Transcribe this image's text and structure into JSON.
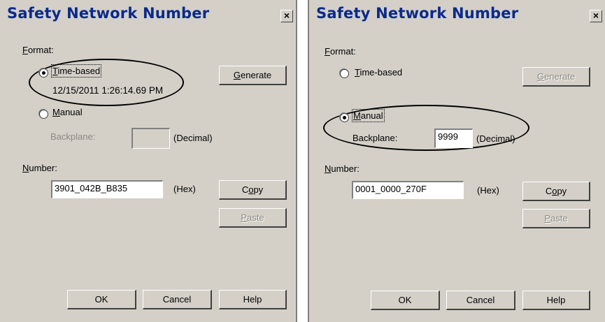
{
  "left_dialog": {
    "title": "Safety Network Number",
    "close": "×",
    "format_label_first": "F",
    "format_label_rest": "ormat:",
    "time_based_label_first": "T",
    "time_based_label_rest": "ime-based",
    "time_based_selected": true,
    "timestamp": "12/15/2011 1:26:14.69 PM",
    "generate_button_first": "G",
    "generate_button_rest": "enerate",
    "manual_label_first": "M",
    "manual_label_rest": "anual",
    "manual_selected": false,
    "backplane_label": "Backplane:",
    "backplane_value": "",
    "decimal_label": "(Decimal)",
    "number_label_first": "N",
    "number_label_rest": "umber:",
    "number_value": "3901_042B_B835",
    "hex_label": "(Hex)",
    "copy_button_first": "C",
    "copy_button_mid": "o",
    "copy_button_rest": "py",
    "paste_button_first": "P",
    "paste_button_rest": "aste",
    "ok_button": "OK",
    "cancel_button": "Cancel",
    "help_button": "Help"
  },
  "right_dialog": {
    "title": "Safety Network Number",
    "close": "×",
    "format_label_first": "F",
    "format_label_rest": "ormat:",
    "time_based_label_first": "T",
    "time_based_label_rest": "ime-based",
    "time_based_selected": false,
    "generate_button_first": "G",
    "generate_button_rest": "enerate",
    "manual_label_first": "M",
    "manual_label_rest": "anual",
    "manual_selected": true,
    "backplane_label": "Backplane:",
    "backplane_value": "9999",
    "decimal_label": "(Decimal)",
    "number_label_first": "N",
    "number_label_rest": "umber:",
    "number_value": "0001_0000_270F",
    "hex_label": "(Hex)",
    "copy_button_first": "C",
    "copy_button_mid": "o",
    "copy_button_rest": "py",
    "paste_button_first": "P",
    "paste_button_rest": "aste",
    "ok_button": "OK",
    "cancel_button": "Cancel",
    "help_button": "Help"
  }
}
